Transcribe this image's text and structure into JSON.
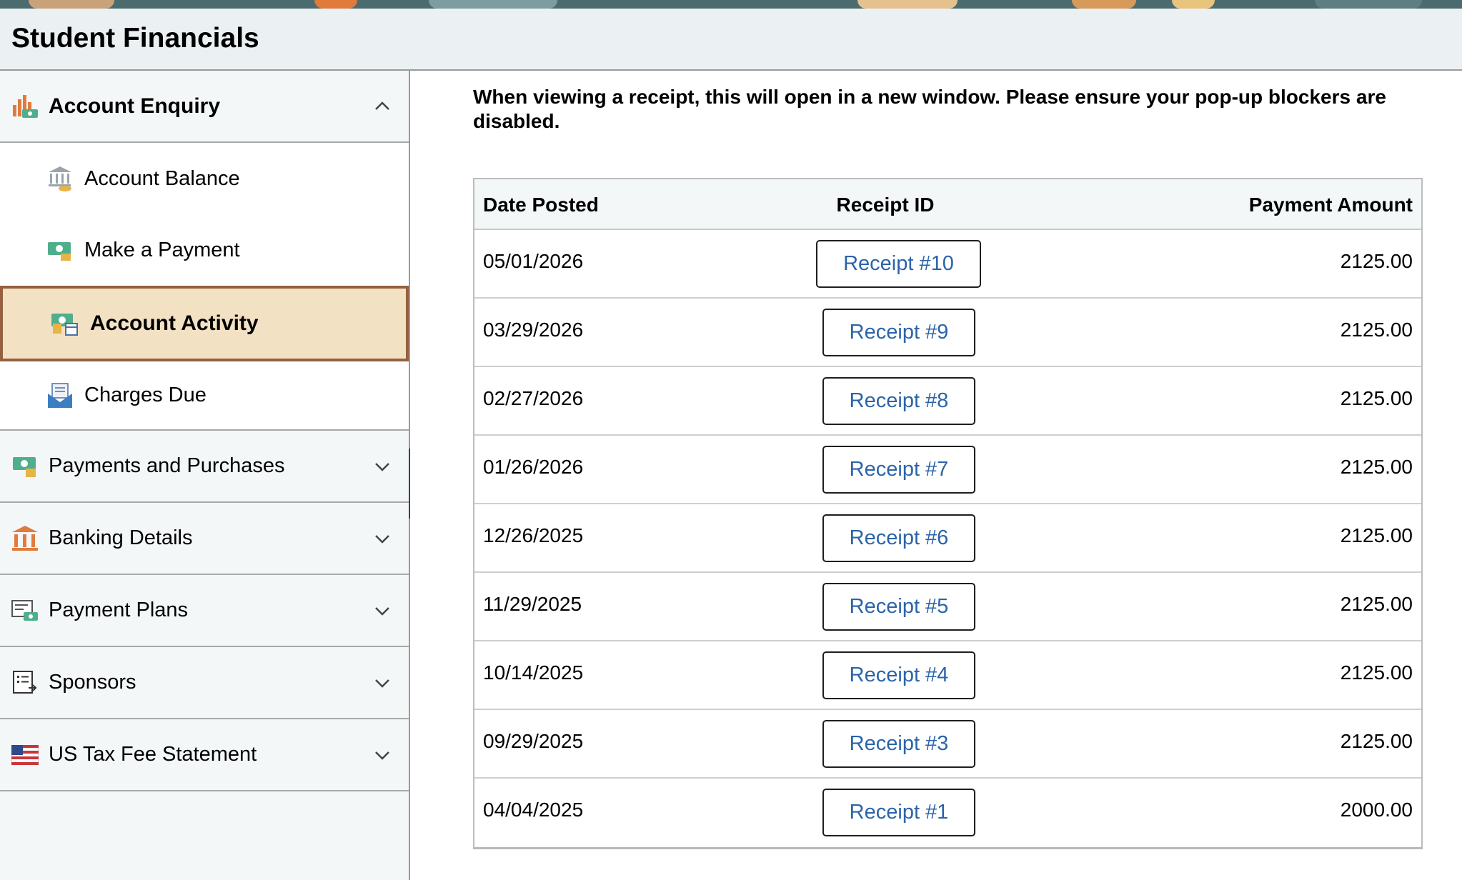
{
  "header": {
    "title": "Student Financials"
  },
  "sidebar": {
    "groups": [
      {
        "label": "Account Enquiry",
        "icon": "bar-chart-money-icon",
        "expanded": true,
        "items": [
          {
            "label": "Account Balance",
            "icon": "bank-coins-icon"
          },
          {
            "label": "Make a Payment",
            "icon": "money-bill-icon"
          },
          {
            "label": "Account Activity",
            "icon": "money-calendar-icon",
            "active": true
          },
          {
            "label": "Charges Due",
            "icon": "envelope-bill-icon"
          }
        ]
      },
      {
        "label": "Payments and Purchases",
        "icon": "money-bill-icon",
        "expanded": false
      },
      {
        "label": "Banking Details",
        "icon": "bank-icon",
        "expanded": false
      },
      {
        "label": "Payment Plans",
        "icon": "payment-plan-icon",
        "expanded": false
      },
      {
        "label": "Sponsors",
        "icon": "sponsor-list-icon",
        "expanded": false
      },
      {
        "label": "US Tax Fee Statement",
        "icon": "us-flag-icon",
        "expanded": false
      }
    ]
  },
  "main": {
    "notice": "When viewing a receipt, this will open in a new window. Please ensure your pop-up blockers are disabled.",
    "table": {
      "headers": {
        "date": "Date Posted",
        "receipt": "Receipt ID",
        "amount": "Payment Amount"
      },
      "rows": [
        {
          "date": "05/01/2026",
          "receipt": "Receipt #10",
          "amount": "2125.00"
        },
        {
          "date": "03/29/2026",
          "receipt": "Receipt #9",
          "amount": "2125.00"
        },
        {
          "date": "02/27/2026",
          "receipt": "Receipt #8",
          "amount": "2125.00"
        },
        {
          "date": "01/26/2026",
          "receipt": "Receipt #7",
          "amount": "2125.00"
        },
        {
          "date": "12/26/2025",
          "receipt": "Receipt #6",
          "amount": "2125.00"
        },
        {
          "date": "11/29/2025",
          "receipt": "Receipt #5",
          "amount": "2125.00"
        },
        {
          "date": "10/14/2025",
          "receipt": "Receipt #4",
          "amount": "2125.00"
        },
        {
          "date": "09/29/2025",
          "receipt": "Receipt #3",
          "amount": "2125.00"
        },
        {
          "date": "04/04/2025",
          "receipt": "Receipt #1",
          "amount": "2000.00"
        }
      ]
    }
  },
  "colors": {
    "header_bg": "#ebf1f2",
    "sidebar_bg": "#f4f7f8",
    "active_bg": "#f3e1c4",
    "active_border": "#94603f",
    "link": "#2b64a8",
    "handle": "#27466e"
  }
}
